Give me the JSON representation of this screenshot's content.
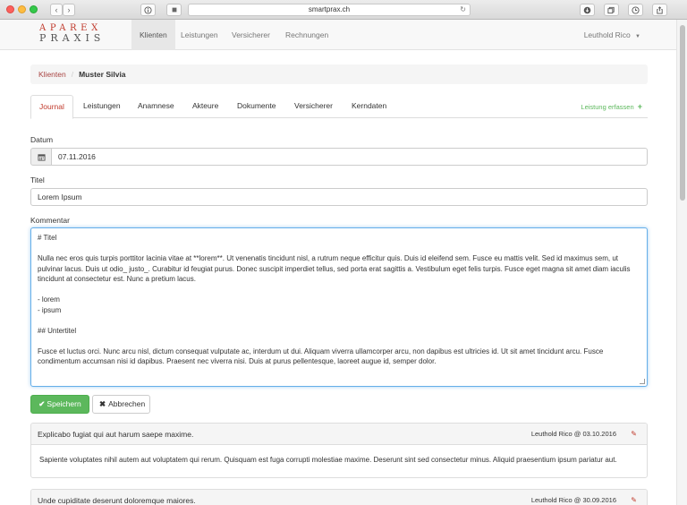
{
  "browser": {
    "url": "smartprax.ch",
    "back_icon": "‹",
    "forward_icon": "›"
  },
  "navbar": {
    "logo_top": "APAREX",
    "logo_bottom": "PRAXIS",
    "items": [
      {
        "label": "Klienten",
        "active": true
      },
      {
        "label": "Leistungen",
        "active": false
      },
      {
        "label": "Versicherer",
        "active": false
      },
      {
        "label": "Rechnungen",
        "active": false
      }
    ],
    "user": "Leuthold Rico"
  },
  "breadcrumb": {
    "parent": "Klienten",
    "current": "Muster Silvia"
  },
  "tabs": [
    {
      "label": "Journal",
      "active": true
    },
    {
      "label": "Leistungen"
    },
    {
      "label": "Anamnese"
    },
    {
      "label": "Akteure"
    },
    {
      "label": "Dokumente"
    },
    {
      "label": "Versicherer"
    },
    {
      "label": "Kerndaten"
    }
  ],
  "tab_action": "Leistung erfassen",
  "form": {
    "datum_label": "Datum",
    "datum_value": "07.11.2016",
    "titel_label": "Titel",
    "titel_value": "Lorem Ipsum",
    "kommentar_label": "Kommentar",
    "kommentar_lines": [
      "# Titel",
      "",
      "Nulla nec eros quis turpis porttitor lacinia vitae at **lorem**. Ut venenatis tincidunt nisl, a rutrum neque efficitur quis. Duis id eleifend sem. Fusce eu mattis velit. Sed id maximus sem, ut pulvinar lacus. Duis ut odio_ justo_. Curabitur id feugiat purus. Donec suscipit imperdiet tellus, sed porta erat sagittis a. Vestibulum eget felis turpis. Fusce eget magna sit amet diam iaculis tincidunt at consectetur est. Nunc a pretium lacus.",
      "",
      "- lorem",
      "- ipsum",
      "",
      "## Untertitel",
      "",
      "Fusce et luctus orci. Nunc arcu nisl, dictum consequat vulputate ac, interdum ut dui. Aliquam viverra ullamcorper arcu, non dapibus est ultricies id. Ut sit amet tincidunt arcu. Fusce condimentum accumsan nisi id dapibus. Praesent nec viverra nisi. Duis at purus pellentesque, laoreet augue id, semper dolor."
    ],
    "save_label": "Speichern",
    "cancel_label": "Abbrechen"
  },
  "entries": [
    {
      "title": "Explicabo fugiat qui aut harum saepe maxime.",
      "meta": "Leuthold Rico @ 03.10.2016",
      "body": "Sapiente voluptates nihil autem aut voluptatem qui rerum. Quisquam est fuga corrupti molestiae maxime. Deserunt sint sed consectetur minus. Aliquid praesentium ipsum pariatur aut."
    },
    {
      "title": "Unde cupiditate deserunt doloremque maiores.",
      "meta": "Leuthold Rico @ 30.09.2016",
      "body": ""
    }
  ],
  "colors": {
    "accent_red": "#c0392b",
    "success_green": "#5cb85c",
    "focus_blue": "#66afe9"
  }
}
